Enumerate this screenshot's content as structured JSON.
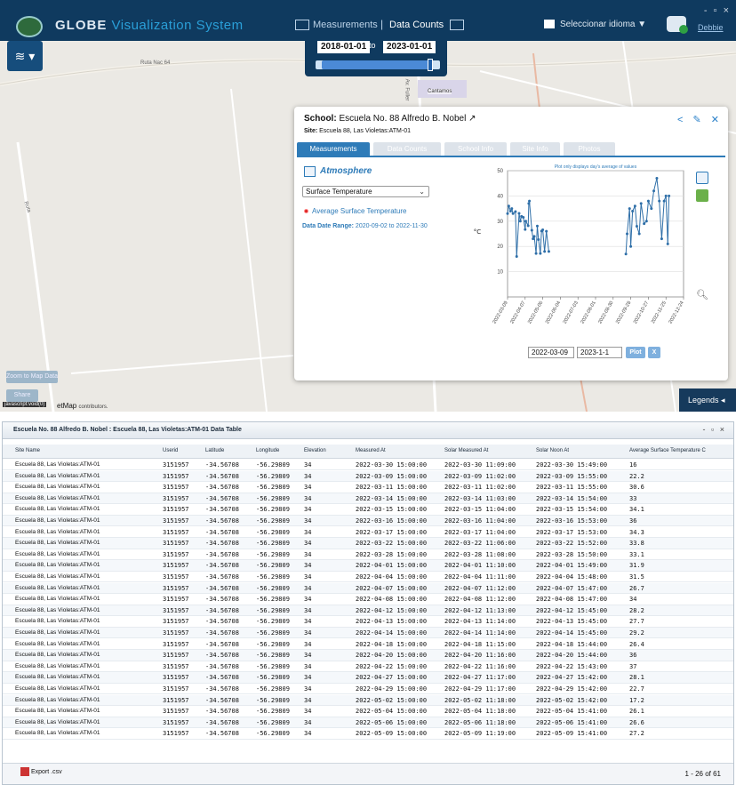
{
  "window": {
    "controls": "- ▫ ×"
  },
  "header": {
    "app_title": "GLOBE",
    "app_subtitle": "Visualization System",
    "nav_measurements": "Measurements",
    "nav_separator": "|",
    "nav_data_counts": "Data Counts",
    "language_label": "Seleccionar idioma ▼",
    "user_link": "Debbie"
  },
  "date_filter": {
    "start": "2018-01-01",
    "to_label": "to",
    "end": "2023-01-01",
    "slider_range": [
      0.05,
      0.92
    ]
  },
  "map": {
    "road_label": "Ruta Nac 64",
    "place_label": "Cantamos",
    "street_label_1": "Av. Fuller",
    "street_label_2": "Ruta",
    "zoom_btn": "Zoom to Map Data",
    "second_btn": "Share",
    "js_void": "javascript:void(0)",
    "attribution_main": "etMap",
    "attribution_sub": "contributors.",
    "legends_label": "Legends ◂"
  },
  "popup": {
    "school_prefix": "School:",
    "school_name": "Escuela No. 88 Alfredo B. Nobel",
    "site_prefix": "Site:",
    "site_name": "Escuela 88, Las Violetas:ATM-01",
    "tabs": [
      "Measurements",
      "Data Counts",
      "School Info",
      "Site Info",
      "Photos"
    ],
    "section_title": "Atmosphere",
    "protocol": "Surface Temperature",
    "series_name": "Average Surface Temperature",
    "range_label": "Data Date Range:",
    "range_value": "2020-09-02 to 2022-11-30",
    "date_from": "2022-03-09",
    "date_to": "2023-1-1",
    "plot_btn": "Plot",
    "clear_btn": "X"
  },
  "chart_data": {
    "type": "line",
    "title": "Plot only displays day's average of values",
    "xlabel": "",
    "ylabel": "°C",
    "ylim": [
      0,
      50
    ],
    "yticks": [
      10,
      20,
      30,
      40,
      50
    ],
    "xticks": [
      "2022-03-09",
      "2022-04-07",
      "2022-05-06",
      "2022-06-04",
      "2022-07-03",
      "2022-08-01",
      "2022-08-30",
      "2022-09-28",
      "2022-10-27",
      "2022-11-25",
      "2022-12-24"
    ],
    "series": [
      {
        "name": "Average Surface Temperature",
        "points": [
          [
            "2022-03-09",
            33
          ],
          [
            "2022-03-11",
            36
          ],
          [
            "2022-03-14",
            34
          ],
          [
            "2022-03-16",
            35
          ],
          [
            "2022-03-18",
            33
          ],
          [
            "2022-03-22",
            33.8
          ],
          [
            "2022-03-24",
            16
          ],
          [
            "2022-03-28",
            33.1
          ],
          [
            "2022-03-30",
            30
          ],
          [
            "2022-04-01",
            31.9
          ],
          [
            "2022-04-04",
            31.5
          ],
          [
            "2022-04-07",
            26.7
          ],
          [
            "2022-04-08",
            30
          ],
          [
            "2022-04-12",
            28.2
          ],
          [
            "2022-04-13",
            37
          ],
          [
            "2022-04-14",
            38
          ],
          [
            "2022-04-18",
            26.4
          ],
          [
            "2022-04-20",
            23
          ],
          [
            "2022-04-22",
            24
          ],
          [
            "2022-04-25",
            17.2
          ],
          [
            "2022-04-27",
            28.1
          ],
          [
            "2022-04-29",
            22.7
          ],
          [
            "2022-05-02",
            17.2
          ],
          [
            "2022-05-04",
            26.1
          ],
          [
            "2022-05-06",
            26.6
          ],
          [
            "2022-05-09",
            18
          ],
          [
            "2022-05-12",
            26
          ],
          [
            "2022-05-16",
            18
          ],
          [
            "2022-09-20",
            17
          ],
          [
            "2022-09-22",
            25
          ],
          [
            "2022-09-26",
            35
          ],
          [
            "2022-09-28",
            20
          ],
          [
            "2022-10-01",
            34
          ],
          [
            "2022-10-05",
            36
          ],
          [
            "2022-10-08",
            28
          ],
          [
            "2022-10-12",
            25
          ],
          [
            "2022-10-15",
            37
          ],
          [
            "2022-10-20",
            29
          ],
          [
            "2022-10-24",
            30
          ],
          [
            "2022-10-27",
            38
          ],
          [
            "2022-11-01",
            35
          ],
          [
            "2022-11-05",
            42
          ],
          [
            "2022-11-10",
            47
          ],
          [
            "2022-11-14",
            38
          ],
          [
            "2022-11-18",
            23
          ],
          [
            "2022-11-22",
            38
          ],
          [
            "2022-11-25",
            40
          ],
          [
            "2022-11-28",
            21
          ],
          [
            "2022-11-30",
            40
          ]
        ]
      }
    ]
  },
  "table": {
    "title": "Escuela No. 88 Alfredo B. Nobel : Escuela 88, Las Violetas:ATM-01 Data Table",
    "columns": [
      "Site Name",
      "Userid",
      "Latitude",
      "Longitude",
      "Elevation",
      "Measured At",
      "Solar Measured At",
      "Solar Noon At",
      "Average Surface Temperature C"
    ],
    "rows": [
      [
        "Escuela 88, Las Violetas:ATM-01",
        "3151957",
        "-34.56708",
        "-56.29809",
        "34",
        "2022-03-30 15:00:00",
        "2022-03-30 11:09:00",
        "2022-03-30 15:49:00",
        "16"
      ],
      [
        "Escuela 88, Las Violetas:ATM-01",
        "3151957",
        "-34.56708",
        "-56.29809",
        "34",
        "2022-03-09 15:00:00",
        "2022-03-09 11:02:00",
        "2022-03-09 15:55:00",
        "22.2"
      ],
      [
        "Escuela 88, Las Violetas:ATM-01",
        "3151957",
        "-34.56708",
        "-56.29809",
        "34",
        "2022-03-11 15:00:00",
        "2022-03-11 11:02:00",
        "2022-03-11 15:55:00",
        "30.6"
      ],
      [
        "Escuela 88, Las Violetas:ATM-01",
        "3151957",
        "-34.56708",
        "-56.29809",
        "34",
        "2022-03-14 15:00:00",
        "2022-03-14 11:03:00",
        "2022-03-14 15:54:00",
        "33"
      ],
      [
        "Escuela 88, Las Violetas:ATM-01",
        "3151957",
        "-34.56708",
        "-56.29809",
        "34",
        "2022-03-15 15:00:00",
        "2022-03-15 11:04:00",
        "2022-03-15 15:54:00",
        "34.1"
      ],
      [
        "Escuela 88, Las Violetas:ATM-01",
        "3151957",
        "-34.56708",
        "-56.29809",
        "34",
        "2022-03-16 15:00:00",
        "2022-03-16 11:04:00",
        "2022-03-16 15:53:00",
        "36"
      ],
      [
        "Escuela 88, Las Violetas:ATM-01",
        "3151957",
        "-34.56708",
        "-56.29809",
        "34",
        "2022-03-17 15:00:00",
        "2022-03-17 11:04:00",
        "2022-03-17 15:53:00",
        "34.3"
      ],
      [
        "Escuela 88, Las Violetas:ATM-01",
        "3151957",
        "-34.56708",
        "-56.29809",
        "34",
        "2022-03-22 15:00:00",
        "2022-03-22 11:06:00",
        "2022-03-22 15:52:00",
        "33.8"
      ],
      [
        "Escuela 88, Las Violetas:ATM-01",
        "3151957",
        "-34.56708",
        "-56.29809",
        "34",
        "2022-03-28 15:00:00",
        "2022-03-28 11:08:00",
        "2022-03-28 15:50:00",
        "33.1"
      ],
      [
        "Escuela 88, Las Violetas:ATM-01",
        "3151957",
        "-34.56708",
        "-56.29809",
        "34",
        "2022-04-01 15:00:00",
        "2022-04-01 11:10:00",
        "2022-04-01 15:49:00",
        "31.9"
      ],
      [
        "Escuela 88, Las Violetas:ATM-01",
        "3151957",
        "-34.56708",
        "-56.29809",
        "34",
        "2022-04-04 15:00:00",
        "2022-04-04 11:11:00",
        "2022-04-04 15:48:00",
        "31.5"
      ],
      [
        "Escuela 88, Las Violetas:ATM-01",
        "3151957",
        "-34.56708",
        "-56.29809",
        "34",
        "2022-04-07 15:00:00",
        "2022-04-07 11:12:00",
        "2022-04-07 15:47:00",
        "26.7"
      ],
      [
        "Escuela 88, Las Violetas:ATM-01",
        "3151957",
        "-34.56708",
        "-56.29809",
        "34",
        "2022-04-08 15:00:00",
        "2022-04-08 11:12:00",
        "2022-04-08 15:47:00",
        "34"
      ],
      [
        "Escuela 88, Las Violetas:ATM-01",
        "3151957",
        "-34.56708",
        "-56.29809",
        "34",
        "2022-04-12 15:00:00",
        "2022-04-12 11:13:00",
        "2022-04-12 15:45:00",
        "28.2"
      ],
      [
        "Escuela 88, Las Violetas:ATM-01",
        "3151957",
        "-34.56708",
        "-56.29809",
        "34",
        "2022-04-13 15:00:00",
        "2022-04-13 11:14:00",
        "2022-04-13 15:45:00",
        "27.7"
      ],
      [
        "Escuela 88, Las Violetas:ATM-01",
        "3151957",
        "-34.56708",
        "-56.29809",
        "34",
        "2022-04-14 15:00:00",
        "2022-04-14 11:14:00",
        "2022-04-14 15:45:00",
        "29.2"
      ],
      [
        "Escuela 88, Las Violetas:ATM-01",
        "3151957",
        "-34.56708",
        "-56.29809",
        "34",
        "2022-04-18 15:00:00",
        "2022-04-18 11:15:00",
        "2022-04-18 15:44:00",
        "26.4"
      ],
      [
        "Escuela 88, Las Violetas:ATM-01",
        "3151957",
        "-34.56708",
        "-56.29809",
        "34",
        "2022-04-20 15:00:00",
        "2022-04-20 11:16:00",
        "2022-04-20 15:44:00",
        "36"
      ],
      [
        "Escuela 88, Las Violetas:ATM-01",
        "3151957",
        "-34.56708",
        "-56.29809",
        "34",
        "2022-04-22 15:00:00",
        "2022-04-22 11:16:00",
        "2022-04-22 15:43:00",
        "37"
      ],
      [
        "Escuela 88, Las Violetas:ATM-01",
        "3151957",
        "-34.56708",
        "-56.29809",
        "34",
        "2022-04-27 15:00:00",
        "2022-04-27 11:17:00",
        "2022-04-27 15:42:00",
        "28.1"
      ],
      [
        "Escuela 88, Las Violetas:ATM-01",
        "3151957",
        "-34.56708",
        "-56.29809",
        "34",
        "2022-04-29 15:00:00",
        "2022-04-29 11:17:00",
        "2022-04-29 15:42:00",
        "22.7"
      ],
      [
        "Escuela 88, Las Violetas:ATM-01",
        "3151957",
        "-34.56708",
        "-56.29809",
        "34",
        "2022-05-02 15:00:00",
        "2022-05-02 11:18:00",
        "2022-05-02 15:42:00",
        "17.2"
      ],
      [
        "Escuela 88, Las Violetas:ATM-01",
        "3151957",
        "-34.56708",
        "-56.29809",
        "34",
        "2022-05-04 15:00:00",
        "2022-05-04 11:18:00",
        "2022-05-04 15:41:00",
        "26.1"
      ],
      [
        "Escuela 88, Las Violetas:ATM-01",
        "3151957",
        "-34.56708",
        "-56.29809",
        "34",
        "2022-05-06 15:00:00",
        "2022-05-06 11:18:00",
        "2022-05-06 15:41:00",
        "26.6"
      ],
      [
        "Escuela 88, Las Violetas:ATM-01",
        "3151957",
        "-34.56708",
        "-56.29809",
        "34",
        "2022-05-09 15:00:00",
        "2022-05-09 11:19:00",
        "2022-05-09 15:41:00",
        "27.2"
      ]
    ],
    "export_label": "Export .csv",
    "pager": "1 - 26 of 61"
  }
}
